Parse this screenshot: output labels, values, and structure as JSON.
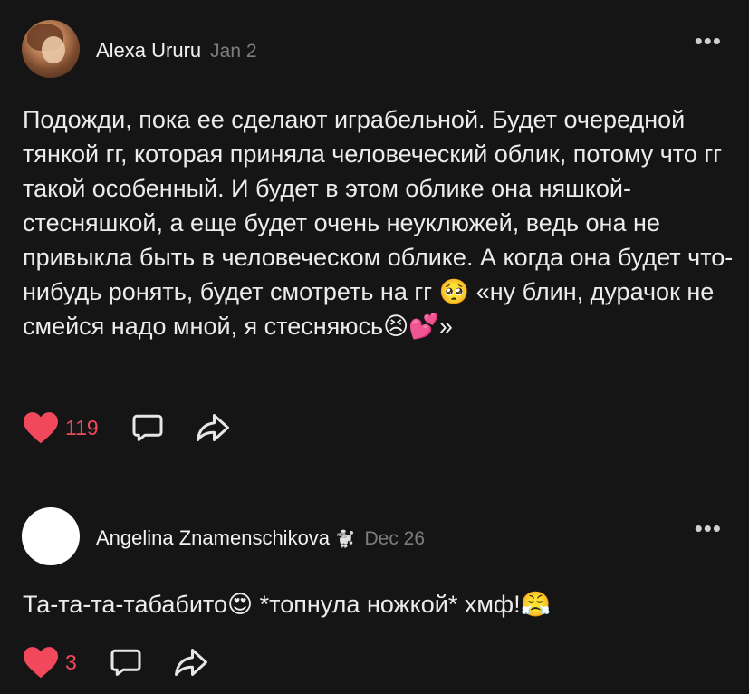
{
  "comments": [
    {
      "author": "Alexa Ururu",
      "badge": "",
      "date": "Jan 2",
      "text": "Подожди, пока ее сделают играбельной. Будет очередной тянкой гг, которая приняла человеческий облик, потому что гг такой особенный. И будет в этом облике она няшкой-стесняшкой, а еще будет очень неуклюжей, ведь она не привыкла быть в человеческом облике. А когда она будет что-нибудь ронять, будет смотреть на гг 🥺 «ну блин, дурачок не смейся надо мной, я стесняюсь😣💕»",
      "likes": "119",
      "icons": {
        "more": "more-dots-icon",
        "like": "heart-icon",
        "reply": "comment-bubble-icon",
        "share": "share-arrow-icon"
      }
    },
    {
      "author": "Angelina Znamenschikova",
      "badge": "🐩",
      "date": "Dec 26",
      "text": "Та-та-та-табабито😍 *топнула ножкой* хмф!😤",
      "likes": "3",
      "icons": {
        "more": "more-dots-icon",
        "like": "heart-icon",
        "reply": "comment-bubble-icon",
        "share": "share-arrow-icon"
      }
    }
  ],
  "colors": {
    "background": "#151515",
    "like_red": "#f1485c",
    "date_gray": "#7d7d7d",
    "text": "#ececec"
  },
  "more_label": "•••"
}
